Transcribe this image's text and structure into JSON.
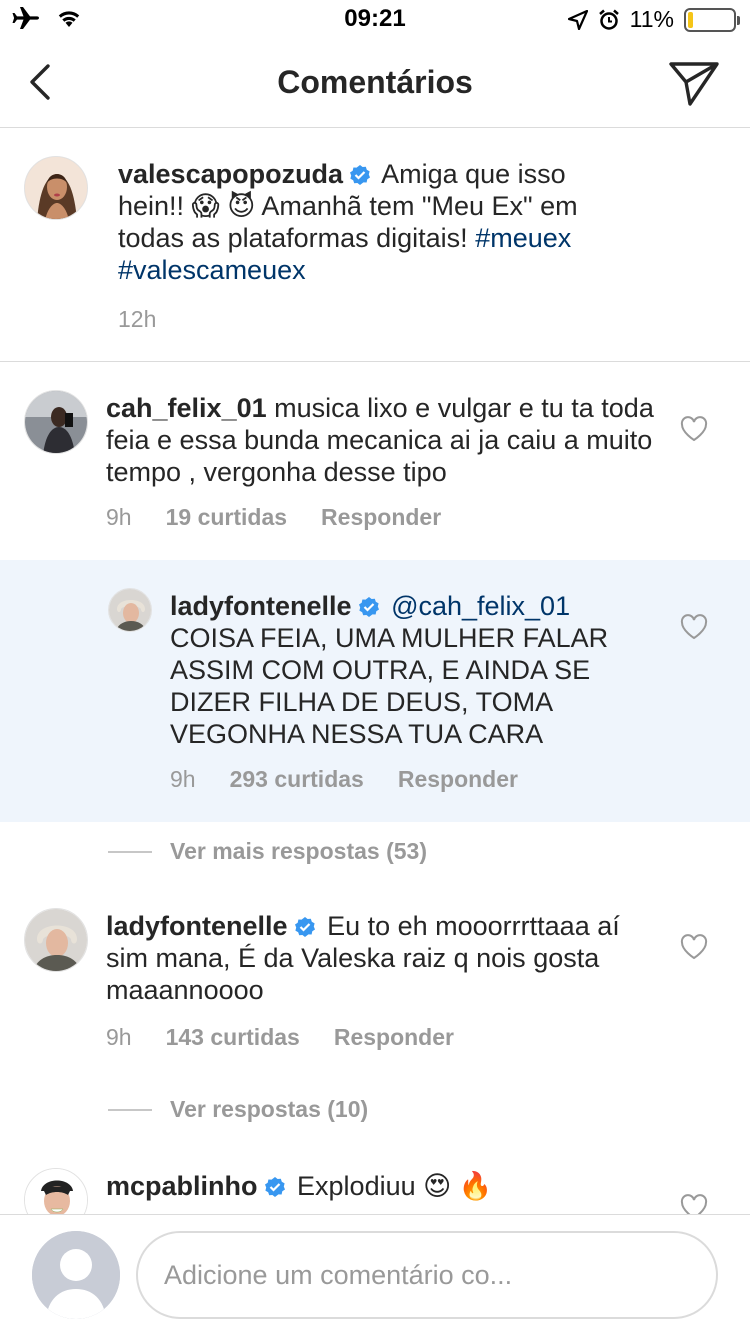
{
  "status_bar": {
    "time": "09:21",
    "battery": "11%",
    "battery_level": 0.11
  },
  "nav": {
    "title": "Comentários"
  },
  "caption": {
    "username": "valescapopozuda",
    "text": "Amiga que isso hein!! 😱 😈  Amanhã tem \"Meu Ex\" em todas as plataformas digitais!",
    "hashtags": [
      "#meuex",
      "#valescameuex"
    ],
    "time": "12h"
  },
  "comments": [
    {
      "username": "cah_felix_01",
      "text": "musica lixo e vulgar e tu ta toda feia e essa bunda mecanica ai ja caiu a muito tempo , vergonha desse tipo",
      "time": "9h",
      "likes": "19 curtidas",
      "reply_label": "Responder"
    },
    {
      "username": "ladyfontenelle",
      "mention": "@cah_felix_01",
      "text": "COISA FEIA, UMA MULHER FALAR ASSIM COM OUTRA, E AINDA SE DIZER FILHA DE DEUS, TOMA VEGONHA NESSA TUA CARA",
      "time": "9h",
      "likes": "293 curtidas",
      "reply_label": "Responder"
    },
    {
      "username": "ladyfontenelle",
      "text": "Eu to eh mooorrrttaaa aí sim mana,  É da Valeska raiz q nois gosta maaannoooo",
      "time": "9h",
      "likes": "143 curtidas",
      "reply_label": "Responder"
    },
    {
      "username": "mcpablinho",
      "text": "Explodiuu 😍 🔥"
    }
  ],
  "more_replies_1": "Ver mais respostas (53)",
  "more_replies_2": "Ver respostas (10)",
  "composer": {
    "placeholder": "Adicione um comentário co..."
  },
  "colors": {
    "link": "#003569",
    "verified": "#3897f0",
    "muted": "#999999",
    "highlight": "#eff5fc"
  }
}
